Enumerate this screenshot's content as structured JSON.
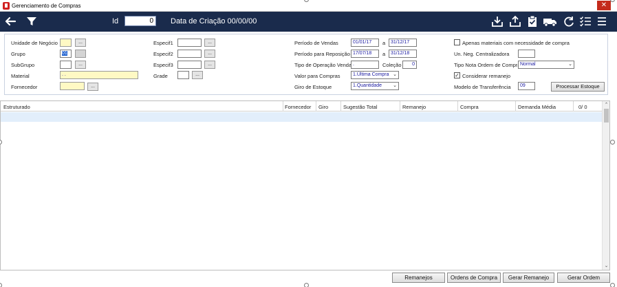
{
  "window": {
    "title": "Gerenciamento de Compras",
    "close_glyph": "✕"
  },
  "toolbar": {
    "id_label": "Id",
    "id_value": "0",
    "date_label": "Data de Criação 00/00/00",
    "icons": [
      "back-arrow-icon",
      "filter-icon",
      "download-icon",
      "upload-icon",
      "clipboard-check-icon",
      "truck-icon",
      "refresh-icon",
      "checklist-icon",
      "menu-icon"
    ]
  },
  "form": {
    "unidade_label": "Unidade de Negócio",
    "unidade_value": "",
    "grupo_label": "Grupo",
    "grupo_value": "01",
    "subgrupo_label": "SubGrupo",
    "subgrupo_value": "",
    "material_label": "Material",
    "material_value": ". .",
    "fornecedor_label": "Fornecedor",
    "fornecedor_value": "",
    "especif1_label": "Especif1",
    "especif2_label": "Especif2",
    "especif3_label": "Especif3",
    "grade_label": "Grade",
    "dots": "...",
    "periodo_vendas_label": "Período de Vendas",
    "periodo_vendas_de": "01/01/17",
    "periodo_vendas_ate": "31/12/17",
    "periodo_reposicao_label": "Período para Reposição",
    "periodo_reposicao_de": "17/07/18",
    "periodo_reposicao_ate": "31/12/18",
    "a_label": "a",
    "tipo_operacao_label": "Tipo de Operação Vendas",
    "tipo_operacao_value": ".",
    "colecao_label": "Coleção",
    "colecao_value": "0",
    "valor_compras_label": "Valor para Compras",
    "valor_compras_value": "1.Última Compra",
    "giro_estoque_label": "Giro de Estoque",
    "giro_estoque_value": "1.Quantidade",
    "apenas_label": "Apenas materiais com necessidade de compra",
    "apenas_checked": false,
    "un_neg_label": "Un. Neg. Centralizadora",
    "un_neg_value": "",
    "tipo_nota_label": "Tipo Nota Ordem de Compra",
    "tipo_nota_value": "Normal",
    "considerar_label": "Considerar remanejo",
    "considerar_checked": true,
    "modelo_label": "Modelo de Transferência",
    "modelo_value": "09",
    "processar_label": "Processar Estoque"
  },
  "grid": {
    "columns": [
      "Estruturado",
      "Fornecedor",
      "Giro",
      "Sugestão Total",
      "Remanejo",
      "Compra",
      "Demanda Média",
      "0/ 0"
    ],
    "rows": []
  },
  "footer": {
    "remanejos_label": "Remanejos",
    "ordens_label": "Ordens de Compra",
    "gerar_remanejo_label": "Gerar Remanejo",
    "gerar_ordem_label": "Gerar Ordem"
  },
  "colors": {
    "toolbar_bg": "#1a2b4c",
    "field_yellow": "#fff9c4",
    "row_highlight": "#e2eefb",
    "close_red": "#c42b1c"
  }
}
